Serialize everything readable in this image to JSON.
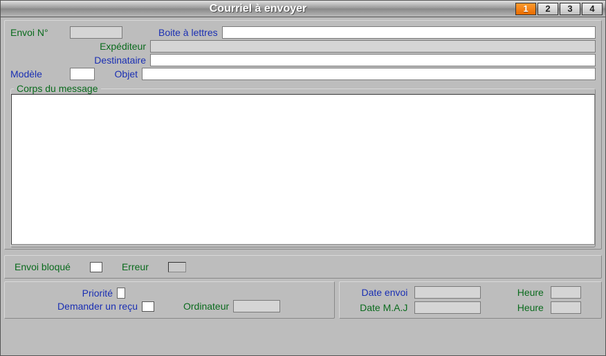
{
  "window": {
    "title": "Courriel à envoyer"
  },
  "tabs": [
    "1",
    "2",
    "3",
    "4"
  ],
  "active_tab": "1",
  "header": {
    "envoi_no_label": "Envoi N°",
    "envoi_no_value": "",
    "boite_label": "Boite à lettres",
    "boite_value": "",
    "expediteur_label": "Expéditeur",
    "expediteur_value": "",
    "destinataire_label": "Destinataire",
    "destinataire_value": "",
    "modele_label": "Modèle",
    "modele_value": "",
    "objet_label": "Objet",
    "objet_value": ""
  },
  "body": {
    "legend": "Corps du message",
    "content": ""
  },
  "status": {
    "bloque_label": "Envoi bloqué",
    "bloque_checked": false,
    "erreur_label": "Erreur",
    "erreur_value": ""
  },
  "bottom_left": {
    "priorite_label": "Priorité",
    "recu_label": "Demander un reçu",
    "recu_checked": false,
    "ordinateur_label": "Ordinateur",
    "ordinateur_value": ""
  },
  "bottom_right": {
    "date_envoi_label": "Date envoi",
    "date_envoi_value": "",
    "heure1_label": "Heure",
    "heure1_value": "",
    "date_maj_label": "Date M.A.J",
    "date_maj_value": "",
    "heure2_label": "Heure",
    "heure2_value": ""
  }
}
